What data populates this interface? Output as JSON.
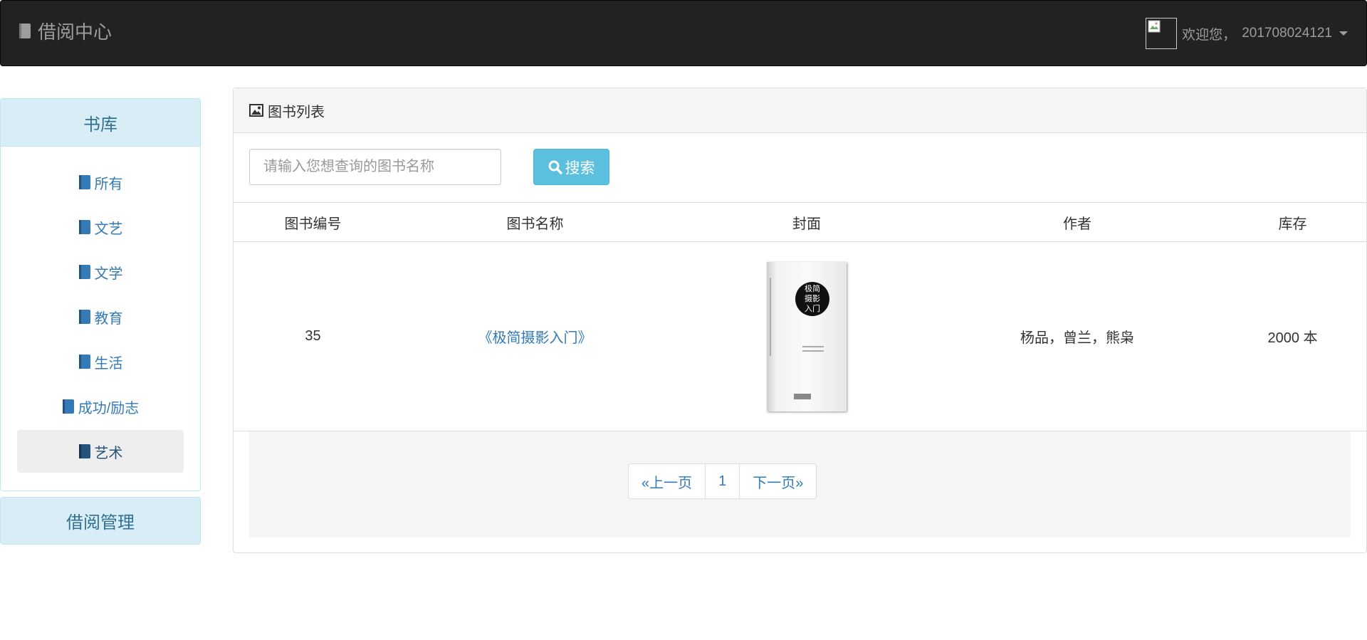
{
  "navbar": {
    "brand": "借阅中心",
    "welcome": "欢迎您，",
    "user_id": "201708024121"
  },
  "sidebar": {
    "library_title": "书库",
    "items": [
      {
        "label": "所有"
      },
      {
        "label": "文艺"
      },
      {
        "label": "文学"
      },
      {
        "label": "教育"
      },
      {
        "label": "生活"
      },
      {
        "label": "成功/励志"
      },
      {
        "label": "艺术",
        "active": true
      }
    ],
    "borrow_title": "借阅管理"
  },
  "main": {
    "title": "图书列表",
    "search": {
      "placeholder": "请输入您想查询的图书名称",
      "button_label": "搜索"
    },
    "table": {
      "headers": [
        "图书编号",
        "图书名称",
        "封面",
        "作者",
        "库存"
      ],
      "rows": [
        {
          "id": "35",
          "name": "《极简摄影入门》",
          "cover_text_1": "极简",
          "cover_text_2": "摄影",
          "cover_text_3": "入门",
          "author": "杨品，曾兰，熊枭",
          "stock": "2000 本"
        }
      ]
    },
    "pagination": {
      "prev": "«上一页",
      "page": "1",
      "next": "下一页»"
    }
  },
  "colors": {
    "navbar_bg": "#222222",
    "panel_info_bg": "#d9edf7",
    "link": "#337ab7",
    "search_button": "#5bc0de"
  }
}
